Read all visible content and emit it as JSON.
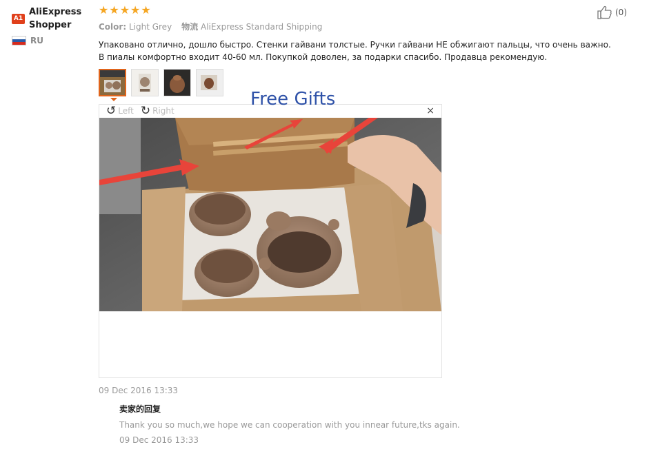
{
  "user": {
    "level_badge": "A1",
    "name": "AliExpress Shopper",
    "country": "RU"
  },
  "review": {
    "rating": 5,
    "color_label": "Color:",
    "color_value": "Light Grey",
    "shipping_label": "物流",
    "shipping_value": "AliExpress Standard Shipping",
    "text": "Упаковано отлично, дошло быстро. Стенки гайвани толстые. Ручки гайвани НЕ обжигают пальцы, что очень важно. В пиалы комфортно входит 40-60 мл. Покупкой доволен, за подарки спасибо. Продавца рекомендую.",
    "date": "09 Dec 2016 13:33",
    "helpful_count": "(0)"
  },
  "viewer": {
    "rotate_left_label": "Left",
    "rotate_right_label": "Right",
    "close_label": "×",
    "caption": "Free Gifts"
  },
  "reply": {
    "title": "卖家的回复",
    "text": "Thank you so much,we hope we can cooperation with you innear future,tks again.",
    "date": "09 Dec 2016 13:33"
  },
  "colors": {
    "accent": "#e0641b",
    "star": "#f5a623",
    "caption": "#2f52a8",
    "badge": "#e0401b"
  },
  "icons": {
    "helpful": "thumbs-up-icon",
    "rotate_left": "rotate-left-icon",
    "rotate_right": "rotate-right-icon",
    "close": "close-icon"
  }
}
